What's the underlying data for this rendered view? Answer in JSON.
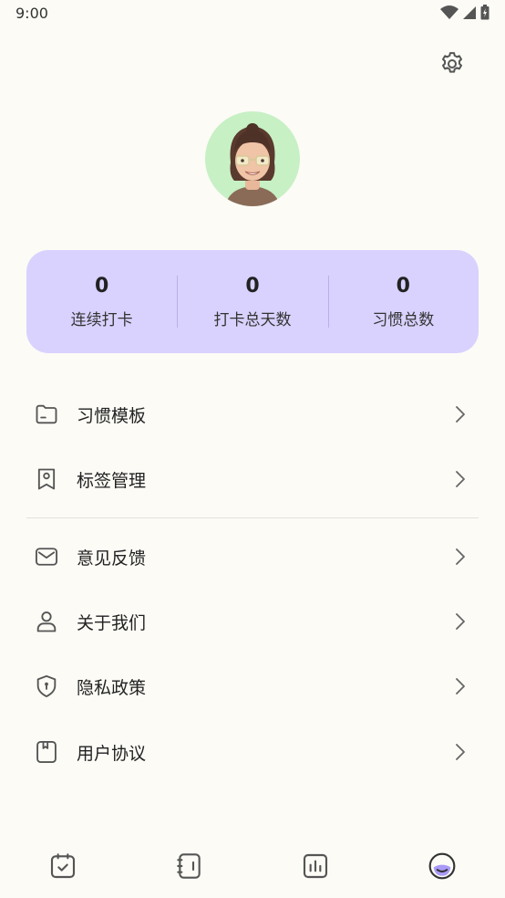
{
  "status_bar": {
    "time": "9:00"
  },
  "stats": [
    {
      "value": "0",
      "label": "连续打卡"
    },
    {
      "value": "0",
      "label": "打卡总天数"
    },
    {
      "value": "0",
      "label": "习惯总数"
    }
  ],
  "menu": {
    "group1": [
      {
        "label": "习惯模板",
        "icon": "folder-icon"
      },
      {
        "label": "标签管理",
        "icon": "bookmark-icon"
      }
    ],
    "group2": [
      {
        "label": "意见反馈",
        "icon": "mail-icon"
      },
      {
        "label": "关于我们",
        "icon": "user-icon"
      },
      {
        "label": "隐私政策",
        "icon": "shield-icon"
      },
      {
        "label": "用户协议",
        "icon": "document-icon"
      }
    ]
  },
  "colors": {
    "background": "#fcfbf6",
    "stats_card": "#d9d2fe",
    "avatar_bg": "#c7f0c4",
    "accent": "#8b7cf6"
  },
  "bottom_nav": [
    {
      "icon": "calendar-check-icon"
    },
    {
      "icon": "notebook-icon"
    },
    {
      "icon": "stats-icon"
    },
    {
      "icon": "profile-face-icon",
      "active": true
    }
  ]
}
